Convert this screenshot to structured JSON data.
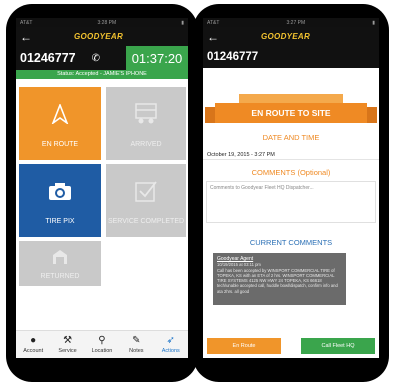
{
  "left": {
    "statusbar": {
      "carrier": "AT&T",
      "time": "3:28 PM"
    },
    "brand": "GOODYEAR",
    "job_number": "01246777",
    "timer": "01:37:20",
    "status_line": "Status: Accepted - JAMIE'S IPHONE",
    "tiles": {
      "en_route": "EN ROUTE",
      "arrived": "ARRIVED",
      "tire_pix": "TIRE PIX",
      "service_completed": "SERVICE COMPLETED",
      "returned": "RETURNED"
    },
    "tabs": [
      "Account",
      "Service",
      "Location",
      "Notes",
      "Actions"
    ],
    "colors": {
      "orange": "#f0952a",
      "blue": "#1f5ca4",
      "green": "#3aa54c",
      "gray": "#c9c9c9"
    }
  },
  "right": {
    "statusbar": {
      "carrier": "AT&T",
      "time": "3:27 PM"
    },
    "brand": "GOODYEAR",
    "job_number": "01246777",
    "banner": "EN ROUTE TO SITE",
    "date_heading": "DATE AND TIME",
    "date_value": "October 19, 2015 - 3:27 PM",
    "comments_heading": "COMMENTS (Optional)",
    "comments_placeholder": "Comments to Goodyear Fleet HQ Dispatcher...",
    "current_heading": "CURRENT COMMENTS",
    "comment": {
      "author": "Goodyear Agent",
      "timestamp": "10/19/2015 at 03:11 pm",
      "text": "Call has been accepted by WINSPORT COMMERCIAL TIRE of TOPEKA, KS with an ETA of 2 hrs. WINSPORT COMMERCIAL TIRE SYSTEMS 4125 NW HWY 24 TOPEKA, KS 66618 tech/unable accepted call, huddle bowl/dispatch, confirm info and ata 2hrs. all good"
    },
    "buttons": {
      "en_route": "En Route",
      "call_fleet": "Call Fleet HQ"
    }
  }
}
